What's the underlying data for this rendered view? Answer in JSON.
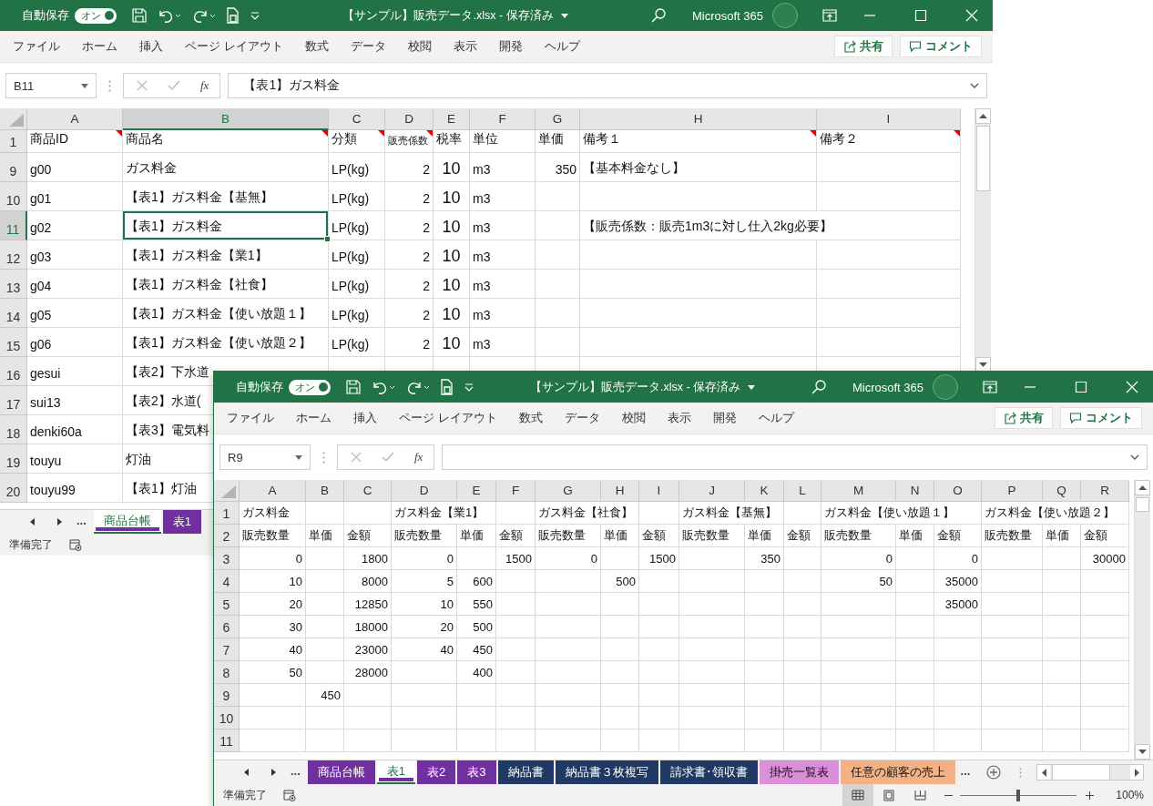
{
  "windows": [
    {
      "title_bar": {
        "autosave_label": "自動保存",
        "autosave": {
          "label": "オン",
          "on": true
        },
        "file_title": "【サンプル】販売データ.xlsx - 保存済み",
        "account": "Microsoft 365"
      },
      "ribbon_tabs": [
        "ファイル",
        "ホーム",
        "挿入",
        "ページ レイアウト",
        "数式",
        "データ",
        "校閲",
        "表示",
        "開発",
        "ヘルプ"
      ],
      "share_button": "共有",
      "comment_button": "コメント",
      "formula_bar": {
        "name_box": "B11",
        "function_label": "fx",
        "formula": "【表1】ガス料金"
      },
      "columns": [
        {
          "letter": "A",
          "selected": false
        },
        {
          "letter": "B",
          "selected": true
        },
        {
          "letter": "C",
          "selected": false
        },
        {
          "letter": "D",
          "selected": false
        },
        {
          "letter": "E",
          "selected": false
        },
        {
          "letter": "F",
          "selected": false
        },
        {
          "letter": "G",
          "selected": false
        },
        {
          "letter": "H",
          "selected": false
        },
        {
          "letter": "I",
          "selected": false
        }
      ],
      "rows": [
        {
          "number": "1",
          "selected": false,
          "cells": [
            {
              "text": "商品ID",
              "comment": true
            },
            {
              "text": "商品名",
              "comment": true
            },
            {
              "text": "分類",
              "comment": true
            },
            {
              "text": "販売係数",
              "comment": true
            },
            {
              "text": "税率",
              "comment": false
            },
            {
              "text": "単位",
              "comment": false
            },
            {
              "text": "単価",
              "comment": false
            },
            {
              "text": "備考１",
              "comment": true
            },
            {
              "text": "備考２",
              "comment": true
            }
          ]
        },
        {
          "number": "9",
          "selected": false,
          "cells": [
            "g00",
            "ガス料金",
            "LP(kg)",
            "2",
            "10",
            "m3",
            "350",
            "【基本料金なし】",
            null
          ]
        },
        {
          "number": "10",
          "selected": false,
          "cells": [
            "g01",
            "【表1】ガス料金【基無】",
            "LP(kg)",
            "2",
            "10",
            "m3",
            null,
            null,
            null
          ]
        },
        {
          "number": "11",
          "selected": true,
          "cells": [
            "g02",
            "【表1】ガス料金",
            "LP(kg)",
            "2",
            "10",
            "m3",
            null,
            "【販売係数：販売1m3に対し仕入2kg必要】",
            null
          ]
        },
        {
          "number": "12",
          "selected": false,
          "cells": [
            "g03",
            "【表1】ガス料金【業1】",
            "LP(kg)",
            "2",
            "10",
            "m3",
            null,
            null,
            null
          ]
        },
        {
          "number": "13",
          "selected": false,
          "cells": [
            "g04",
            "【表1】ガス料金【社食】",
            "LP(kg)",
            "2",
            "10",
            "m3",
            null,
            null,
            null
          ]
        },
        {
          "number": "14",
          "selected": false,
          "cells": [
            "g05",
            "【表1】ガス料金【使い放題１】",
            "LP(kg)",
            "2",
            "10",
            "m3",
            null,
            null,
            null
          ]
        },
        {
          "number": "15",
          "selected": false,
          "cells": [
            "g06",
            "【表1】ガス料金【使い放題２】",
            "LP(kg)",
            "2",
            "10",
            "m3",
            null,
            null,
            null
          ]
        },
        {
          "number": "16",
          "selected": false,
          "cells": [
            "gesui",
            "【表2】下水道",
            null,
            null,
            null,
            null,
            null,
            null,
            null
          ]
        },
        {
          "number": "17",
          "selected": false,
          "cells": [
            "sui13",
            "【表2】水道("
          ]
        },
        {
          "number": "18",
          "selected": false,
          "cells": [
            "denki60a",
            "【表3】電気料"
          ]
        },
        {
          "number": "19",
          "selected": false,
          "cells": [
            "touyu",
            "灯油"
          ]
        },
        {
          "number": "20",
          "selected": false,
          "cells": [
            "touyu99",
            "【表1】灯油"
          ]
        }
      ],
      "sheet_nav_more": "...",
      "sheet_tabs": [
        {
          "label": "商品台帳",
          "selected": true,
          "color": "#7030a0"
        },
        {
          "label": "表1",
          "selected": false,
          "color": "#7030a0"
        }
      ],
      "status": "準備完了"
    },
    {
      "title_bar": {
        "autosave_label": "自動保存",
        "autosave": {
          "label": "オン",
          "on": true
        },
        "file_title": "【サンプル】販売データ.xlsx - 保存済み",
        "account": "Microsoft 365"
      },
      "ribbon_tabs": [
        "ファイル",
        "ホーム",
        "挿入",
        "ページ レイアウト",
        "数式",
        "データ",
        "校閲",
        "表示",
        "開発",
        "ヘルプ"
      ],
      "share_button": "共有",
      "comment_button": "コメント",
      "formula_bar": {
        "name_box": "R9",
        "function_label": "fx"
      },
      "columns": [
        {
          "letter": "A",
          "selected": false
        },
        {
          "letter": "B",
          "selected": false
        },
        {
          "letter": "C",
          "selected": false
        },
        {
          "letter": "D",
          "selected": false
        },
        {
          "letter": "E",
          "selected": false
        },
        {
          "letter": "F",
          "selected": false
        },
        {
          "letter": "G",
          "selected": false
        },
        {
          "letter": "H",
          "selected": false
        },
        {
          "letter": "I",
          "selected": false
        },
        {
          "letter": "J",
          "selected": false
        },
        {
          "letter": "K",
          "selected": false
        },
        {
          "letter": "L",
          "selected": false
        },
        {
          "letter": "M",
          "selected": false
        },
        {
          "letter": "N",
          "selected": false
        },
        {
          "letter": "O",
          "selected": false
        },
        {
          "letter": "P",
          "selected": false
        },
        {
          "letter": "Q",
          "selected": false
        },
        {
          "letter": "R",
          "selected": false
        }
      ],
      "rows": [
        {
          "number": "1",
          "selected": false,
          "cells": [
            "ガス料金",
            null,
            null,
            "ガス料金【業1】",
            null,
            null,
            "ガス料金【社食】",
            null,
            null,
            "ガス料金【基無】",
            null,
            null,
            "ガス料金【使い放題１】",
            null,
            null,
            "ガス料金【使い放題２】",
            null,
            null
          ]
        },
        {
          "number": "2",
          "selected": false,
          "cells": [
            "販売数量",
            "単価",
            "金額",
            "販売数量",
            "単価",
            "金額",
            "販売数量",
            "単価",
            "金額",
            "販売数量",
            "単価",
            "金額",
            "販売数量",
            "単価",
            "金額",
            "販売数量",
            "単価",
            "金額"
          ]
        },
        {
          "number": "3",
          "selected": false,
          "cells": [
            "0",
            null,
            "1800",
            "0",
            null,
            "1500",
            "0",
            null,
            "1500",
            null,
            "350",
            null,
            "0",
            null,
            "0",
            null,
            null,
            "30000"
          ]
        },
        {
          "number": "4",
          "selected": false,
          "cells": [
            "10",
            null,
            "8000",
            "5",
            "600",
            null,
            null,
            "500",
            null,
            null,
            null,
            null,
            "50",
            null,
            "35000",
            null,
            null,
            null
          ]
        },
        {
          "number": "5",
          "selected": false,
          "cells": [
            "20",
            null,
            "12850",
            "10",
            "550",
            null,
            null,
            null,
            null,
            null,
            null,
            null,
            null,
            null,
            "35000",
            null,
            null,
            null
          ]
        },
        {
          "number": "6",
          "selected": false,
          "cells": [
            "30",
            null,
            "18000",
            "20",
            "500",
            null,
            null,
            null,
            null,
            null,
            null,
            null,
            null,
            null,
            null,
            null,
            null,
            null
          ]
        },
        {
          "number": "7",
          "selected": false,
          "cells": [
            "40",
            null,
            "23000",
            "40",
            "450",
            null,
            null,
            null,
            null,
            null,
            null,
            null,
            null,
            null,
            null,
            null,
            null,
            null
          ]
        },
        {
          "number": "8",
          "selected": false,
          "cells": [
            "50",
            null,
            "28000",
            null,
            "400",
            null,
            null,
            null,
            null,
            null,
            null,
            null,
            null,
            null,
            null,
            null,
            null,
            null
          ]
        },
        {
          "number": "9",
          "selected": false,
          "cells": [
            null,
            "450",
            null,
            null,
            null,
            null,
            null,
            null,
            null,
            null,
            null,
            null,
            null,
            null,
            null,
            null,
            null,
            null
          ]
        },
        {
          "number": "10",
          "selected": false,
          "cells": [
            null,
            null,
            null,
            null,
            null,
            null,
            null,
            null,
            null,
            null,
            null,
            null,
            null,
            null,
            null,
            null,
            null,
            null
          ]
        },
        {
          "number": "11",
          "selected": false,
          "cells": [
            null,
            null,
            null,
            null,
            null,
            null,
            null,
            null,
            null,
            null,
            null,
            null,
            null,
            null,
            null,
            null,
            null,
            null
          ]
        }
      ],
      "sheet_nav_more": "...",
      "sheet_tabs": [
        {
          "label": "商品台帳",
          "selected": false,
          "color": "#7030a0"
        },
        {
          "label": "表1",
          "selected": true,
          "color": "#7030a0"
        },
        {
          "label": "表2",
          "selected": false,
          "color": "#7030a0"
        },
        {
          "label": "表3",
          "selected": false,
          "color": "#7030a0"
        },
        {
          "label": "納品書",
          "selected": false,
          "color": "#1f3864"
        },
        {
          "label": "納品書３枚複写",
          "selected": false,
          "color": "#1f3864"
        },
        {
          "label": "請求書･領収書",
          "selected": false,
          "color": "#1f3864"
        },
        {
          "label": "掛売一覧表",
          "selected": false,
          "color": "#da8fd8"
        },
        {
          "label": "任意の顧客の売上",
          "selected": false,
          "color": "#f4b183"
        }
      ],
      "sheet_tabs_more": "...",
      "status": "準備完了",
      "view_buttons": [
        {
          "selected": true
        },
        {
          "selected": false
        },
        {
          "selected": false
        }
      ],
      "zoom": {
        "level": 0.5,
        "reading": "100%"
      }
    }
  ]
}
